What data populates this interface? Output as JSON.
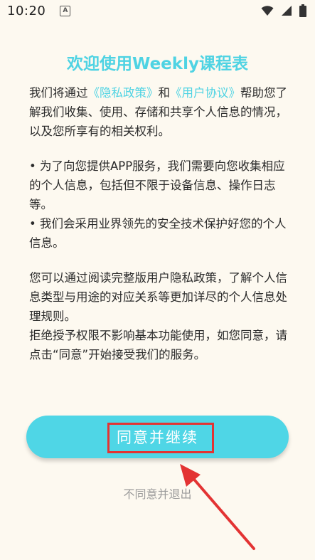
{
  "status_bar": {
    "time": "10:20",
    "notification_icon": "a-icon",
    "wifi_icon": "wifi-icon",
    "signal_icon": "signal-icon",
    "battery_icon": "battery-icon"
  },
  "dialog": {
    "title": "欢迎使用Weekly课程表",
    "intro": {
      "before": "我们将通过",
      "privacy_link": "《隐私政策》",
      "and": "和",
      "agreement_link": "《用户协议》",
      "after": "帮助您了解我们收集、使用、存储和共享个人信息的情况，以及您所享有的相关权利。"
    },
    "bullet_1": "• 为了向您提供APP服务，我们需要向您收集相应的个人信息，包括但不限于设备信息、操作日志等。",
    "bullet_2": "• 我们会采用业界领先的安全技术保护好您的个人信息。",
    "para_3": "您可以通过阅读完整版用户隐私政策，了解个人信息类型与用途的对应关系等更加详尽的个人信息处理规则。",
    "para_4": "拒绝授予权限不影响基本功能使用，如您同意，请点击“同意”开始接受我们的服务。",
    "agree_button": "同意并继续",
    "decline_link": "不同意并退出"
  },
  "colors": {
    "accent": "#4fd3e3",
    "button": "#4fd6e6",
    "annotation": "#e33333",
    "background": "#fdf9f0"
  }
}
